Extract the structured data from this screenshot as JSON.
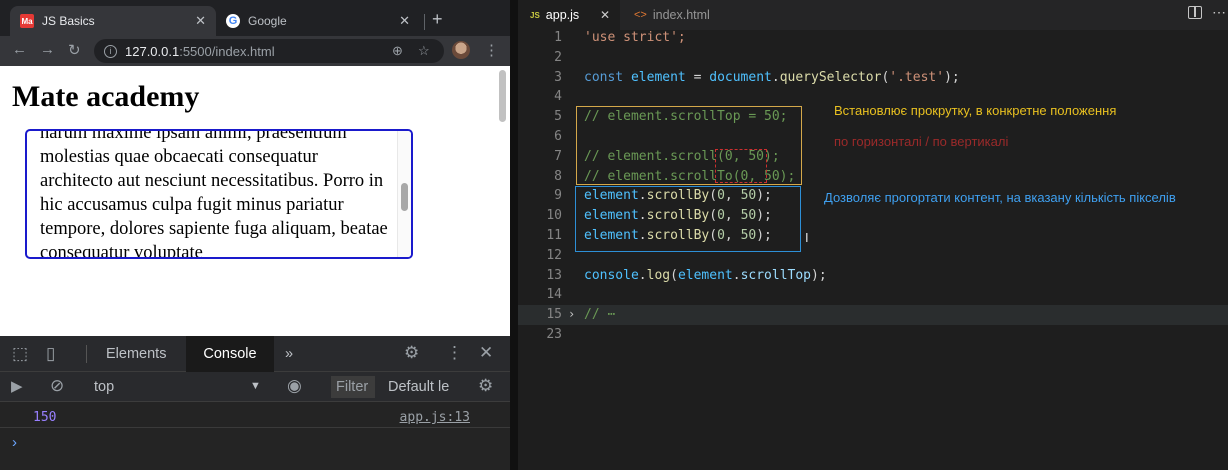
{
  "browser": {
    "tabs": [
      {
        "favicon": "Ma",
        "title": "JS Basics",
        "close": "✕"
      },
      {
        "favicon": "G",
        "title": "Google",
        "close": "✕"
      }
    ],
    "new_tab": "+",
    "url_host": "127.0.0.1",
    "url_path": ":5500/index.html",
    "page_heading": "Mate academy",
    "box_text": "harum maxime ipsam animi, praesentium molestias quae obcaecati consequatur architecto aut nesciunt necessitatibus. Porro in hic accusamus culpa fugit minus pariatur tempore, dolores sapiente fuga aliquam, beatae consequatur voluptate"
  },
  "devtools": {
    "tabs": [
      "Elements",
      "Console"
    ],
    "more": "»",
    "context": "top",
    "filter_placeholder": "Filter",
    "levels": "Default le",
    "log_value": "150",
    "log_source": "app.js:13",
    "prompt": "›"
  },
  "editor": {
    "tabs": [
      {
        "badge": "JS",
        "title": "app.js",
        "close": "✕"
      },
      {
        "badge": "<>",
        "title": "index.html"
      }
    ],
    "line_numbers": [
      "1",
      "2",
      "3",
      "4",
      "5",
      "6",
      "7",
      "8",
      "9",
      "10",
      "11",
      "12",
      "13",
      "14",
      "15",
      "23"
    ],
    "code": {
      "use_strict": "'use strict';",
      "const_kw": "const",
      "element_var": "element",
      "document_var": "document",
      "query_fn": "querySelector",
      "selector_str": "'.test'",
      "c5": "// element.scrollTop = 50;",
      "c7": "// element.scroll(0, 50);",
      "c8": "// element.scrollTo(0, 50);",
      "scrollBy_fn": "scrollBy",
      "n0": "0",
      "n50": "50",
      "console_var": "console",
      "log_fn": "log",
      "scrollTop_prop": "scrollTop",
      "collapsed": "// ⋯"
    },
    "notes": {
      "n1": "Встановлює прокрутку, в конкретне положення",
      "n2": "по горизонталі / по вертикалі",
      "n3": "Дозволяє прогортати контент, на вказану кількість пікселів"
    }
  },
  "colors": {
    "note_yellow": "#e8c020",
    "note_red": "#9b2a2a",
    "note_blue": "#3fa0f0",
    "box_border": "#1a1acc"
  }
}
